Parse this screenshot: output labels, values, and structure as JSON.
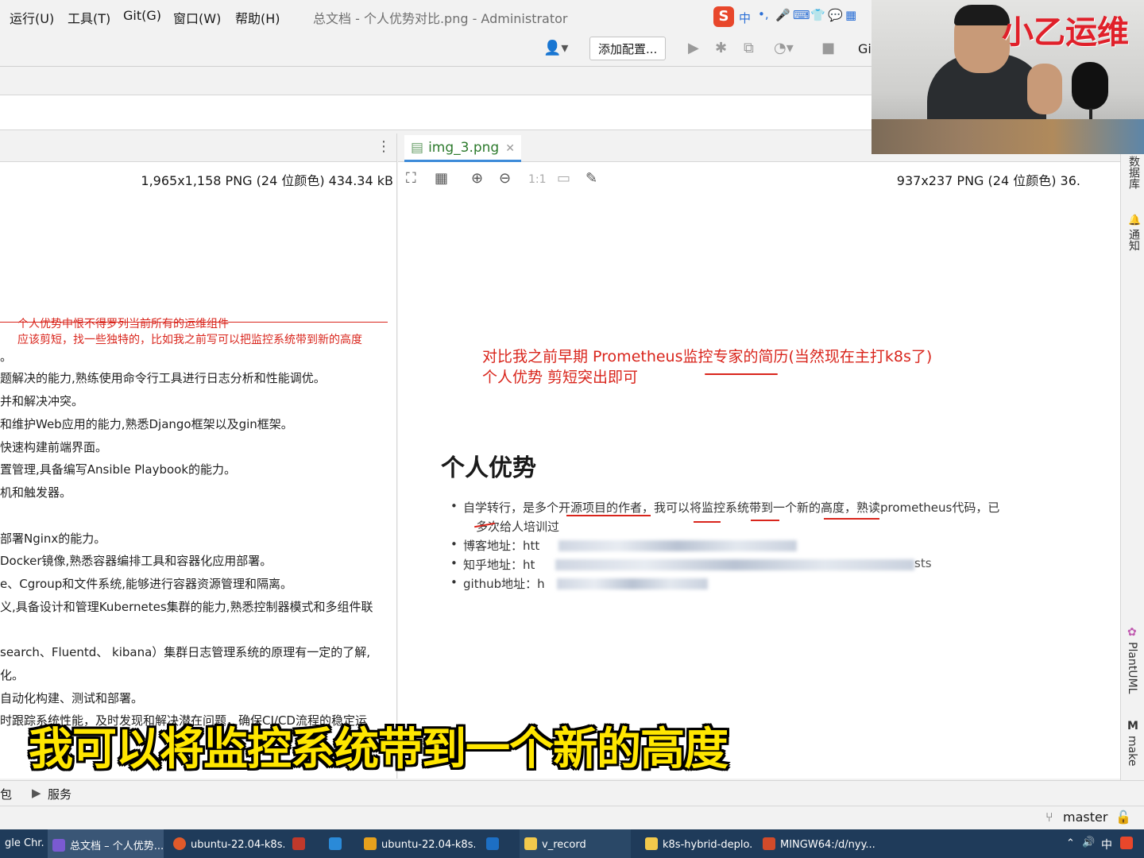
{
  "menubar": {
    "items": [
      "运行(U)",
      "工具(T)",
      "Git(G)",
      "窗口(W)",
      "帮助(H)"
    ],
    "window_title": "总文档 - 个人优势对比.png - Administrator"
  },
  "toolbar": {
    "add_config_label": "添加配置...",
    "git_label": "Gi"
  },
  "left_editor": {
    "image_info": "1,965x1,158 PNG (24 位颜色) 434.34 kB",
    "annotation_1": "个人优势中恨不得罗列当前所有的运维组件",
    "annotation_2": "应该剪短，找一些独特的，比如我之前写可以把监控系统带到新的高度",
    "lines": [
      "。",
      "题解决的能力,熟练使用命令行工具进行日志分析和性能调优。",
      "并和解决冲突。",
      "和维护Web应用的能力,熟悉Django框架以及gin框架。",
      "快速构建前端界面。",
      "置管理,具备编写Ansible Playbook的能力。",
      "机和触发器。",
      "",
      "部署Nginx的能力。",
      "Docker镜像,熟悉容器编排工具和容器化应用部署。",
      "e、Cgroup和文件系统,能够进行容器资源管理和隔离。",
      "义,具备设计和管理Kubernetes集群的能力,熟悉控制器模式和多组件联",
      "",
      "search、Fluentd、 kibana）集群日志管理系统的原理有一定的了解,",
      "化。",
      "自动化构建、测试和部署。",
      "时跟踪系统性能，及时发现和解决潜在问题，确保CI/CD流程的稳定运"
    ]
  },
  "right_editor": {
    "tab_label": "img_3.png",
    "image_info": "937x237 PNG (24 位颜色) 36.",
    "zoom_label": "1:1",
    "annotation_1": "对比我之前早期 Prometheus监控专家的简历(当然现在主打k8s了)",
    "annotation_2": "个人优势 剪短突出即可",
    "heading": "个人优势",
    "bullets": [
      "自学转行，是多个开源项目的作者，我可以将监控系统带到一个新的高度，熟读prometheus代码，已",
      "多次给人培训过",
      "博客地址：htt",
      "知乎地址：ht",
      "github地址：h"
    ],
    "zhihu_suffix": "sts"
  },
  "right_stripe": {
    "items": [
      "数据库",
      "通知",
      "PlantUML",
      "make"
    ]
  },
  "bottom_bar": {
    "left_fragment": "包",
    "services_label": "服务"
  },
  "status_bar": {
    "branch": "master"
  },
  "taskbar": {
    "items": [
      "gle Chr...",
      "总文档 – 个人优势...",
      "ubuntu-22.04-k8s...",
      "ubuntu-22.04-k8s...",
      "v_record",
      "k8s-hybrid-deplo...",
      "MINGW64:/d/nyy..."
    ],
    "tray_ime": "中"
  },
  "webcam": {
    "logo_text": "小乙运维"
  },
  "subtitle": {
    "text": "我可以将监控系统带到一个新的高度"
  },
  "ime_bar": {
    "label": "中"
  },
  "colors": {
    "annotation_red": "#d9251c",
    "subtitle_yellow": "#ffe600",
    "tab_underline": "#3d8bd9",
    "taskbar_bg": "#1f3b5a"
  }
}
